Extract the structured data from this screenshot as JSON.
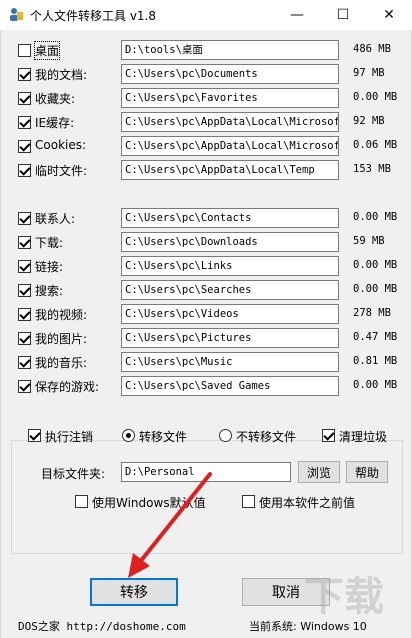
{
  "window": {
    "title": "个人文件转移工具 v1.8",
    "controls": {
      "minimize": "—",
      "maximize": "☐",
      "close": "✕"
    }
  },
  "items_group1": [
    {
      "label": "桌面",
      "checked": false,
      "path": "D:\\tools\\桌面",
      "size": "486 MB"
    },
    {
      "label": "我的文档:",
      "checked": true,
      "path": "C:\\Users\\pc\\Documents",
      "size": "97 MB"
    },
    {
      "label": "收藏夹:",
      "checked": true,
      "path": "C:\\Users\\pc\\Favorites",
      "size": "0.00 MB"
    },
    {
      "label": "IE缓存:",
      "checked": true,
      "path": "C:\\Users\\pc\\AppData\\Local\\Microsoft\\",
      "size": "92 MB"
    },
    {
      "label": "Cookies:",
      "checked": true,
      "path": "C:\\Users\\pc\\AppData\\Local\\Microsoft\\",
      "size": "0.06 MB"
    },
    {
      "label": "临时文件:",
      "checked": true,
      "path": "C:\\Users\\pc\\AppData\\Local\\Temp",
      "size": "153 MB"
    }
  ],
  "items_group2": [
    {
      "label": "联系人:",
      "checked": true,
      "path": "C:\\Users\\pc\\Contacts",
      "size": "0.00 MB"
    },
    {
      "label": "下载:",
      "checked": true,
      "path": "C:\\Users\\pc\\Downloads",
      "size": "59 MB"
    },
    {
      "label": "链接:",
      "checked": true,
      "path": "C:\\Users\\pc\\Links",
      "size": "0.00 MB"
    },
    {
      "label": "搜索:",
      "checked": true,
      "path": "C:\\Users\\pc\\Searches",
      "size": "0.00 MB"
    },
    {
      "label": "我的视频:",
      "checked": true,
      "path": "C:\\Users\\pc\\Videos",
      "size": "278 MB"
    },
    {
      "label": "我的图片:",
      "checked": true,
      "path": "C:\\Users\\pc\\Pictures",
      "size": "0.47 MB"
    },
    {
      "label": "我的音乐:",
      "checked": true,
      "path": "C:\\Users\\pc\\Music",
      "size": "0.81 MB"
    },
    {
      "label": "保存的游戏:",
      "checked": true,
      "path": "C:\\Users\\pc\\Saved Games",
      "size": "0.00 MB"
    }
  ],
  "options": {
    "execute_logout": {
      "label": "执行注销",
      "checked": true
    },
    "transfer_files": {
      "label": "转移文件",
      "selected": true
    },
    "no_transfer_files": {
      "label": "不转移文件",
      "selected": false
    },
    "clean_junk": {
      "label": "清理垃圾",
      "checked": true
    }
  },
  "target": {
    "label": "目标文件夹:",
    "value": "D:\\Personal",
    "browse": "浏览",
    "help": "帮助",
    "use_windows_default": {
      "label": "使用Windows默认值",
      "checked": false
    },
    "use_previous": {
      "label": "使用本软件之前值",
      "checked": false
    }
  },
  "actions": {
    "transfer": "转移",
    "cancel": "取消"
  },
  "footer": {
    "site": "DOS之家 http://doshome.com",
    "system": "当前系统: Windows 10"
  },
  "colors": {
    "annotation_arrow": "#e02020",
    "default_button_border": "#0078d7"
  }
}
